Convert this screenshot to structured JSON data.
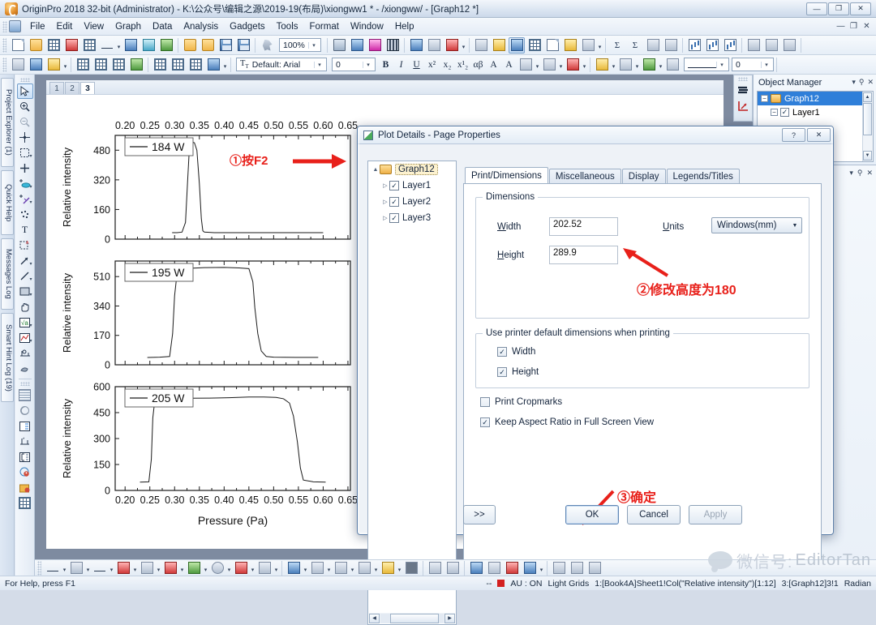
{
  "window": {
    "title": "OriginPro 2018 32-bit (Administrator) - K:\\公众号\\编辑之源\\2019-19(布局)\\xiongww1 * - /xiongww/ - [Graph12 *]",
    "minimize": "—",
    "maximize": "❐",
    "close": "✕",
    "doc_minimize": "—",
    "doc_restore": "❐",
    "doc_close": "✕"
  },
  "menu": {
    "items": [
      "File",
      "Edit",
      "View",
      "Graph",
      "Data",
      "Analysis",
      "Gadgets",
      "Tools",
      "Format",
      "Window",
      "Help"
    ]
  },
  "toolbars": {
    "zoom_value": "100%",
    "font_value": "Default: Arial",
    "fontsize_value": "0",
    "linewidth_value": "0",
    "bold": "B",
    "italic": "I",
    "underline": "U",
    "superscript": "x²",
    "subscript": "x₂",
    "subsup": "x¹₂",
    "greek": "αβ",
    "increase_font": "A",
    "decrease_font": "A",
    "sigma": "Σ"
  },
  "left_docks": [
    "Project Explorer (1)",
    "Quick Help",
    "Messages Log",
    "Smart Hint Log (19)"
  ],
  "graph_window": {
    "tabs": [
      "1",
      "2",
      "3"
    ],
    "active_tab": "3"
  },
  "annotations": {
    "step1": "①按F2",
    "step2": "②修改高度为180",
    "step3": "③确定"
  },
  "object_manager": {
    "title": "Object Manager",
    "menu_icon": "▾",
    "pin_icon": "⚲",
    "close_icon": "✕",
    "rows": [
      {
        "label": "Graph12",
        "type": "folder",
        "selected": true,
        "expander": "−"
      },
      {
        "label": "Layer1",
        "type": "layer",
        "selected": false,
        "expander": "−",
        "checked": true
      }
    ]
  },
  "dialog": {
    "title": "Plot Details - Page Properties",
    "help_btn": "?",
    "close_btn": "✕",
    "tree": [
      {
        "label": "Graph12",
        "level": 0,
        "expander": "▲",
        "type": "folder",
        "selected": true
      },
      {
        "label": "Layer1",
        "level": 1,
        "expander": "▷",
        "type": "layer",
        "checked": true
      },
      {
        "label": "Layer2",
        "level": 1,
        "expander": "▷",
        "type": "layer",
        "checked": true
      },
      {
        "label": "Layer3",
        "level": 1,
        "expander": "▷",
        "type": "layer",
        "checked": true
      }
    ],
    "tabs": [
      {
        "label": "Print/Dimensions",
        "active": true
      },
      {
        "label": "Miscellaneous",
        "active": false
      },
      {
        "label": "Display",
        "active": false
      },
      {
        "label": "Legends/Titles",
        "active": false
      }
    ],
    "dimensions": {
      "group_label": "Dimensions",
      "width_label": "Width",
      "width_value": "202.52",
      "height_label": "Height",
      "height_value": "289.9",
      "units_label": "Units",
      "units_value": "Windows(mm)"
    },
    "printer_group": {
      "group_label": "Use printer default dimensions when printing",
      "width_label": "Width",
      "width_checked": true,
      "height_label": "Height",
      "height_checked": true
    },
    "cropmarks": {
      "label": "Print Cropmarks",
      "checked": false
    },
    "aspect": {
      "label": "Keep Aspect Ratio in Full Screen View",
      "checked": true
    },
    "buttons": {
      "more": ">>",
      "ok": "OK",
      "cancel": "Cancel",
      "apply": "Apply"
    }
  },
  "status_bar": {
    "help": "For Help, press F1",
    "dash": "--",
    "au": "AU : ON",
    "grids": "Light Grids",
    "dataset": "1:[Book4A]Sheet1!Col(\"Relative intensity\")[1:12]",
    "layer": "3:[Graph12]3!1",
    "angle": "Radian"
  },
  "watermark": {
    "cn": "微信号:",
    "name": "EditorTan"
  },
  "chart_data": [
    {
      "type": "line",
      "title": "184 W",
      "legend": "184 W",
      "xlabel": "",
      "ylabel": "Relative intensity",
      "xlim": [
        0.18,
        0.655
      ],
      "ylim": [
        0,
        560
      ],
      "yticks": [
        0,
        160,
        320,
        480
      ],
      "xticks": [
        0.2,
        0.25,
        0.3,
        0.35,
        0.4,
        0.45,
        0.5,
        0.55,
        0.6,
        0.65
      ],
      "xaxis_position": "top",
      "x": [
        0.295,
        0.305,
        0.315,
        0.322,
        0.326,
        0.33,
        0.335,
        0.34,
        0.345,
        0.35,
        0.354,
        0.357,
        0.36,
        0.38,
        0.42,
        0.47,
        0.52,
        0.56,
        0.6
      ],
      "y": [
        35,
        35,
        38,
        90,
        300,
        500,
        525,
        520,
        480,
        300,
        110,
        45,
        38,
        35,
        35,
        35,
        35,
        35,
        35
      ]
    },
    {
      "type": "line",
      "title": "195 W",
      "legend": "195 W",
      "xlabel": "",
      "ylabel": "Relative intensity",
      "xlim": [
        0.18,
        0.655
      ],
      "ylim": [
        0,
        600
      ],
      "yticks": [
        0,
        170,
        340,
        510
      ],
      "xticks": [
        0.2,
        0.25,
        0.3,
        0.35,
        0.4,
        0.45,
        0.5,
        0.55,
        0.6,
        0.65
      ],
      "xaxis_position": "none",
      "x": [
        0.245,
        0.27,
        0.29,
        0.296,
        0.3,
        0.305,
        0.315,
        0.33,
        0.36,
        0.4,
        0.43,
        0.45,
        0.458,
        0.462,
        0.468,
        0.475,
        0.485,
        0.5,
        0.545,
        0.59
      ],
      "y": [
        42,
        44,
        48,
        180,
        400,
        530,
        550,
        558,
        562,
        563,
        560,
        556,
        480,
        330,
        180,
        80,
        48,
        44,
        43,
        43
      ]
    },
    {
      "type": "line",
      "title": "205 W",
      "legend": "205 W",
      "xlabel": "Pressure (Pa)",
      "ylabel": "Relative intensity",
      "xlim": [
        0.18,
        0.655
      ],
      "ylim": [
        0,
        600
      ],
      "yticks": [
        0,
        150,
        300,
        450,
        600
      ],
      "xticks": [
        0.2,
        0.25,
        0.3,
        0.35,
        0.4,
        0.45,
        0.5,
        0.55,
        0.6,
        0.65
      ],
      "xaxis_position": "bottom",
      "x": [
        0.23,
        0.248,
        0.253,
        0.256,
        0.26,
        0.28,
        0.31,
        0.33,
        0.37,
        0.41,
        0.45,
        0.48,
        0.505,
        0.52,
        0.532,
        0.54,
        0.548,
        0.554,
        0.56,
        0.58,
        0.605
      ],
      "y": [
        48,
        50,
        180,
        420,
        520,
        525,
        528,
        533,
        534,
        536,
        540,
        540,
        538,
        530,
        505,
        430,
        280,
        130,
        60,
        50,
        48
      ]
    }
  ]
}
